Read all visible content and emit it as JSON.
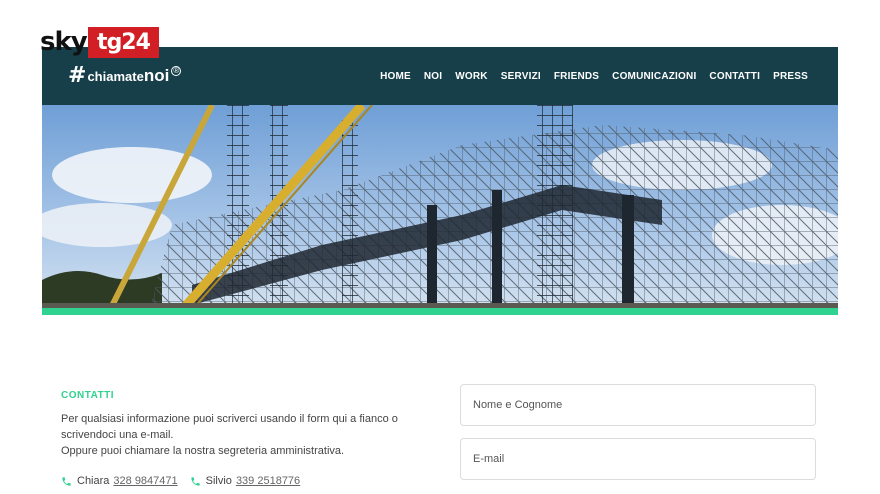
{
  "watermark": {
    "sky": "sky",
    "tg": "tg24"
  },
  "brand": {
    "hash": "#",
    "word_a": "chiamate",
    "word_b": "noi",
    "reg": "®"
  },
  "nav": [
    {
      "label": "HOME"
    },
    {
      "label": "NOI"
    },
    {
      "label": "WORK"
    },
    {
      "label": "SERVIZI"
    },
    {
      "label": "FRIENDS"
    },
    {
      "label": "COMUNICAZIONI"
    },
    {
      "label": "CONTATTI"
    },
    {
      "label": "PRESS"
    }
  ],
  "contact": {
    "title": "CONTATTI",
    "line1": "Per qualsiasi informazione puoi scriverci usando il form qui a fianco o scrivendoci una e-mail.",
    "line2": "Oppure puoi chiamare la nostra segreteria amministrativa.",
    "phones": [
      {
        "name": "Chiara",
        "number": "328 9847471"
      },
      {
        "name": "Silvio",
        "number": "339 2518776"
      }
    ]
  },
  "form": {
    "name_placeholder": "Nome e Cognome",
    "email_placeholder": "E-mail"
  },
  "colors": {
    "header": "#163f49",
    "accent": "#2fd28f",
    "tg_red": "#d21f26"
  }
}
